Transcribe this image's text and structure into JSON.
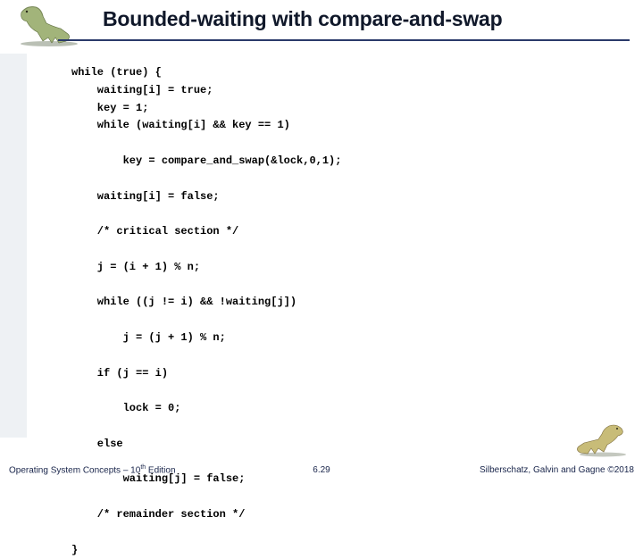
{
  "header": {
    "title": "Bounded-waiting with compare-and-swap"
  },
  "code": "while (true) {\n    waiting[i] = true;\n    key = 1;\n    while (waiting[i] && key == 1)\n\n        key = compare_and_swap(&lock,0,1);\n\n    waiting[i] = false;\n\n    /* critical section */\n\n    j = (i + 1) % n;\n\n    while ((j != i) && !waiting[j])\n\n        j = (j + 1) % n;\n\n    if (j == i)\n\n        lock = 0;\n\n    else\n\n        waiting[j] = false;\n\n    /* remainder section */\n\n}",
  "footer": {
    "left_prefix": "Operating System Concepts – 10",
    "left_suffix": " Edition",
    "left_sup": "th",
    "center": "6.29",
    "right": "Silberschatz, Galvin and Gagne ©2018"
  }
}
